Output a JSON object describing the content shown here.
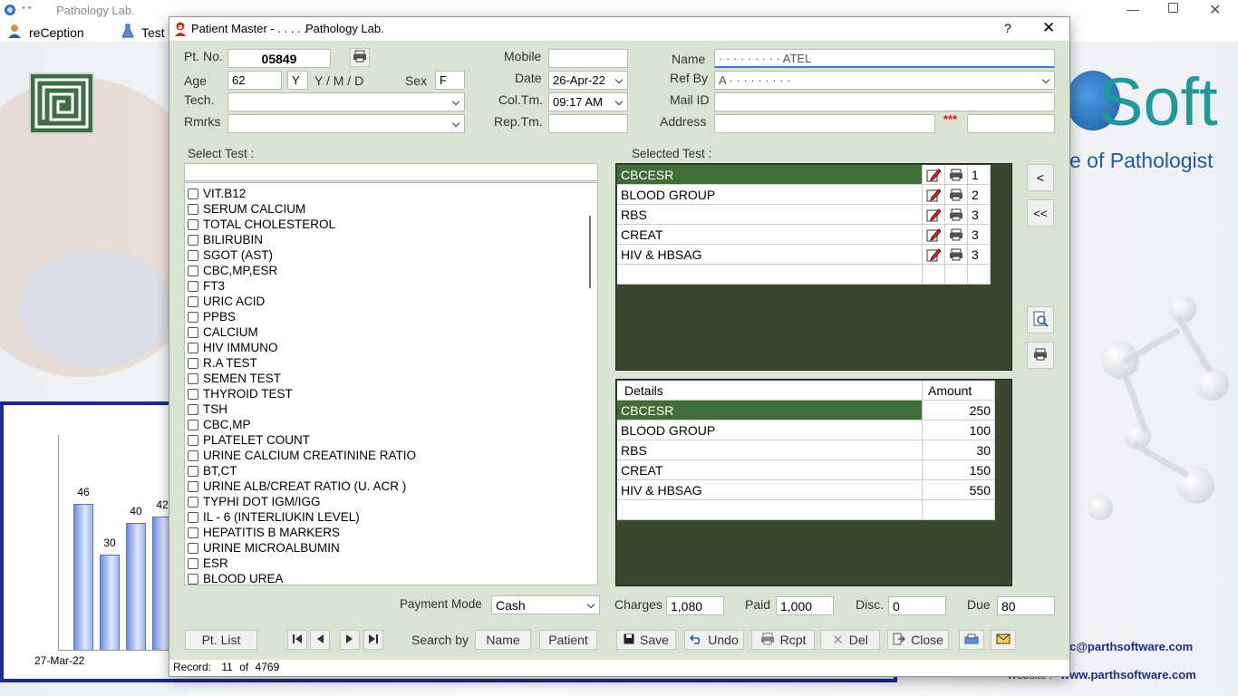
{
  "app": {
    "title": "Pathology Lab.",
    "menu": [
      {
        "label": "reCeption",
        "icon": "user-icon"
      },
      {
        "label": "Test",
        "icon": "flask-icon"
      }
    ],
    "brand_text": "Soft",
    "tagline": "e of Pathologist",
    "email": "c@parthsoftware.com",
    "website_label": "Website :",
    "website": "www.parthsoftware.com",
    "chart_date": "27-Mar-22"
  },
  "chart_data": {
    "type": "bar",
    "categories": [
      "27-Mar-22",
      "",
      "",
      ""
    ],
    "values": [
      46,
      30,
      40,
      42
    ],
    "title": "",
    "xlabel": "",
    "ylabel": ""
  },
  "dialog": {
    "title": "Patient Master - . . . . .",
    "subtitle": "Pathology Lab.",
    "help": "?",
    "close": "✕"
  },
  "form": {
    "pt_no_label": "Pt. No.",
    "pt_no": "05849",
    "age_label": "Age",
    "age": "62",
    "age_unit": "Y",
    "age_units_hint": "Y / M / D",
    "sex_label": "Sex",
    "sex": "F",
    "tech_label": "Tech.",
    "tech": "",
    "rmrks_label": "Rmrks",
    "rmrks": "",
    "mobile_label": "Mobile",
    "mobile": "",
    "date_label": "Date",
    "date": "26-Apr-22",
    "coltm_label": "Col.Tm.",
    "coltm": "09:17 AM",
    "reptm_label": "Rep.Tm.",
    "reptm": "",
    "name_label": "Name",
    "name": "· · · · · ·  ·  ·  · ATEL",
    "refby_label": "Ref By",
    "refby": "A  · · · · · ·  · · ·",
    "mail_label": "Mail ID",
    "mail": "",
    "address_label": "Address",
    "address": "",
    "address_marker": "***",
    "address2": ""
  },
  "select_test": {
    "label": "Select Test :",
    "search": "",
    "items": [
      "VIT.B12",
      "SERUM CALCIUM",
      "TOTAL CHOLESTEROL",
      "BILIRUBIN",
      "SGOT (AST)",
      "CBC,MP,ESR",
      "FT3",
      "URIC ACID",
      "PPBS",
      "CALCIUM",
      "HIV IMMUNO",
      "R.A TEST",
      "SEMEN TEST",
      "THYROID TEST",
      "TSH",
      "CBC,MP",
      "PLATELET COUNT",
      "URINE CALCIUM CREATININE RATIO",
      "BT,CT",
      "URINE ALB/CREAT RATIO (U. ACR )",
      "TYPHI DOT  IGM/IGG",
      "IL - 6 (INTERLIUKIN LEVEL)",
      "HEPATITIS B MARKERS",
      "URINE MICROALBUMIN",
      "ESR",
      "BLOOD UREA"
    ]
  },
  "selected_test": {
    "label": "Selected Test :",
    "rows": [
      {
        "name": "CBCESR",
        "n": "1"
      },
      {
        "name": "BLOOD GROUP",
        "n": "2"
      },
      {
        "name": "RBS",
        "n": "3"
      },
      {
        "name": "CREAT",
        "n": "3"
      },
      {
        "name": "HIV & HBSAG",
        "n": "3"
      }
    ]
  },
  "details": {
    "col_details": "Details",
    "col_amount": "Amount",
    "rows": [
      {
        "name": "CBCESR",
        "amount": "250"
      },
      {
        "name": "BLOOD GROUP",
        "amount": "100"
      },
      {
        "name": "RBS",
        "amount": "30"
      },
      {
        "name": "CREAT",
        "amount": "150"
      },
      {
        "name": "HIV & HBSAG",
        "amount": "550"
      }
    ]
  },
  "side_buttons": {
    "remove_one": "<",
    "remove_all": "<<"
  },
  "payment": {
    "mode_label": "Payment Mode",
    "mode": "Cash",
    "charges_label": "Charges",
    "charges": "1,080",
    "paid_label": "Paid",
    "paid": "1,000",
    "disc_label": "Disc.",
    "disc": "0",
    "due_label": "Due",
    "due": "80"
  },
  "toolbar": {
    "pt_list": "Pt. List",
    "search_by": "Search by",
    "name": "Name",
    "patient": "Patient",
    "save": "Save",
    "undo": "Undo",
    "rcpt": "Rcpt",
    "del": "Del",
    "close": "Close"
  },
  "status": {
    "record_label": "Record:",
    "current": "11",
    "of": "of",
    "total": "4769"
  },
  "colors": {
    "panel": "#d9e4d2",
    "grid_bg": "#38482e",
    "selected": "#3f6e36",
    "brand": "#1f6bb5"
  }
}
